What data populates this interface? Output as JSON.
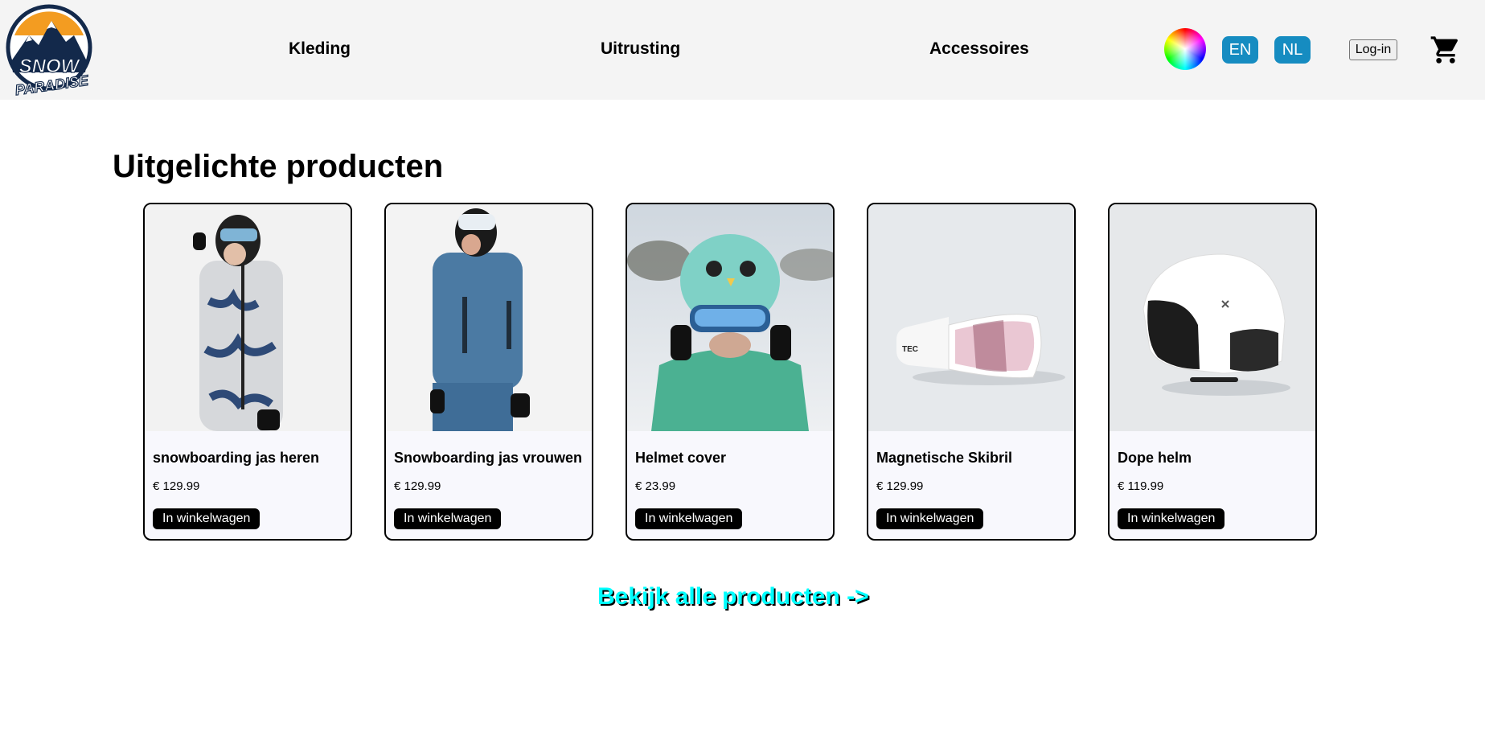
{
  "header": {
    "logo_text_top": "SNOW",
    "logo_text_bottom": "PARADISE",
    "nav": [
      "Kleding",
      "Uitrusting",
      "Accessoires"
    ],
    "lang_en": "EN",
    "lang_nl": "NL",
    "login": "Log-in"
  },
  "main": {
    "title": "Uitgelichte producten",
    "products": [
      {
        "name": "snowboarding jas heren",
        "price": "€ 129.99",
        "button": "In winkelwagen"
      },
      {
        "name": "Snowboarding jas vrouwen",
        "price": "€ 129.99",
        "button": "In winkelwagen"
      },
      {
        "name": "Helmet cover",
        "price": "€ 23.99",
        "button": "In winkelwagen"
      },
      {
        "name": "Magnetische Skibril",
        "price": "€ 129.99",
        "button": "In winkelwagen"
      },
      {
        "name": "Dope helm",
        "price": "€ 119.99",
        "button": "In winkelwagen"
      }
    ],
    "see_all": "Bekijk alle producten ->"
  },
  "colors": {
    "header_bg": "#f4f4f4",
    "lang_button": "#168cc1",
    "link_accent": "#00ffff",
    "card_bg": "#f8f8fd"
  },
  "icons": [
    "snow-paradise-logo",
    "color-wheel-icon",
    "cart-icon"
  ]
}
